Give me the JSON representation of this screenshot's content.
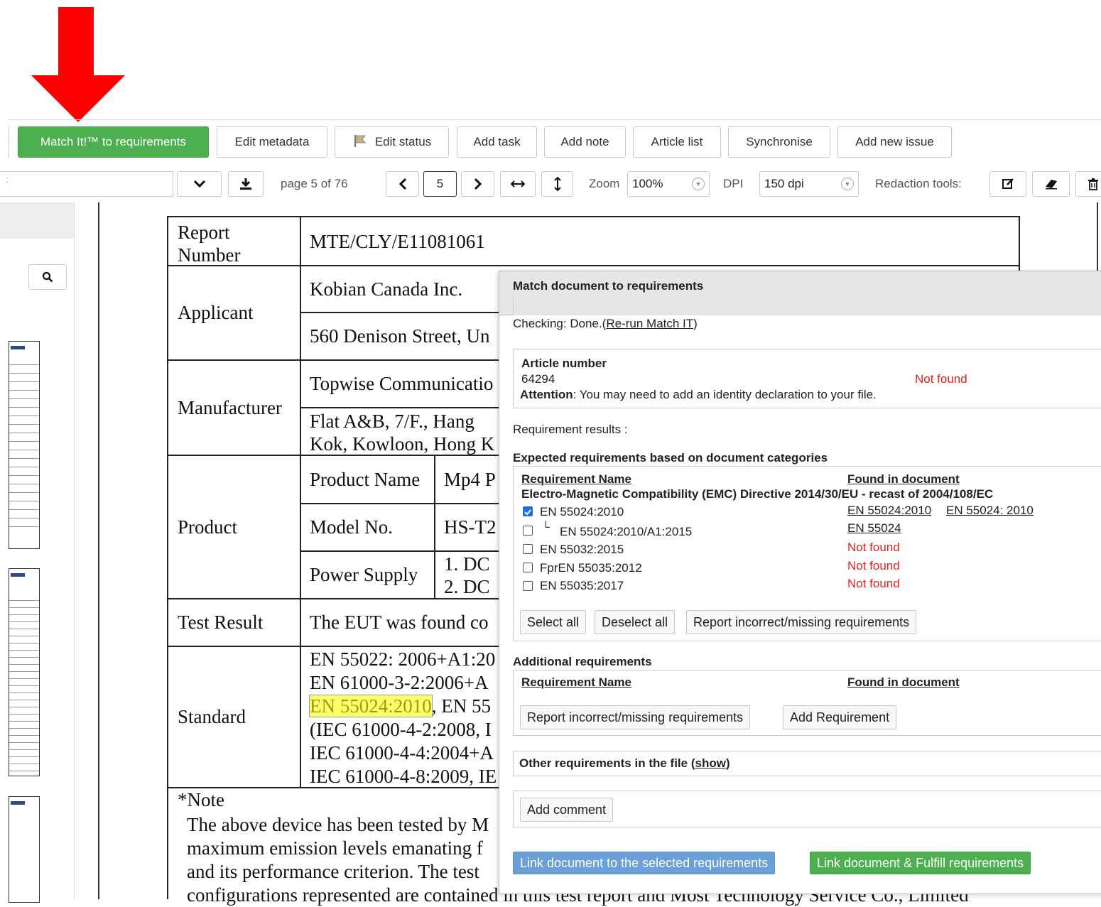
{
  "toolbar": {
    "match_label": "Match It!™ to requirements",
    "edit_metadata": "Edit metadata",
    "edit_status": "Edit status",
    "add_task": "Add task",
    "add_note": "Add note",
    "article_list": "Article list",
    "synchronise": "Synchronise",
    "add_new_issue": "Add new issue"
  },
  "viewer": {
    "page_info": "page 5 of 76",
    "page_input": "5",
    "zoom_label": "Zoom",
    "zoom_value": "100%",
    "dpi_label": "DPI",
    "dpi_value": "150 dpi",
    "redaction_label": "Redaction tools:"
  },
  "document": {
    "report_number_label_1": "Report",
    "report_number_label_2": "Number",
    "report_number": "MTE/CLY/E11081061",
    "applicant_label": "Applicant",
    "applicant_name": "Kobian Canada Inc.",
    "applicant_address": "560 Denison Street, Un",
    "manufacturer_label": "Manufacturer",
    "manufacturer_name": "Topwise Communicatio",
    "manufacturer_address_1": "Flat A&B, 7/F., Hang",
    "manufacturer_address_2": "Kok, Kowloon, Hong K",
    "product_label": "Product",
    "product_name_label": "Product Name",
    "product_name": "Mp4 P",
    "model_label": "Model No.",
    "model": "HS-T2",
    "power_label": "Power Supply",
    "power_1": "1. DC",
    "power_2": "2. DC",
    "test_result_label": "Test Result",
    "test_result": "The EUT was found co",
    "standard_label": "Standard",
    "standard_1": "EN 55022: 2006+A1:20",
    "standard_2": "EN 61000-3-2:2006+A",
    "standard_3_hl": "EN 55024:2010",
    "standard_3_rest": ", EN 55",
    "standard_4": "(IEC 61000-4-2:2008, I",
    "standard_5": "IEC 61000-4-4:2004+A",
    "standard_6": "IEC 61000-4-8:2009, IE",
    "note_label": "*Note",
    "note_1": "The above device has been tested by M",
    "note_2": "maximum emission levels emanating f",
    "note_3": "and its performance criterion. The test",
    "note_4": "configurations represented are contained in this test report and Most Technology Service Co., Limited"
  },
  "panel": {
    "title": "Match document to requirements",
    "checking_prefix": "Checking: Done.(",
    "rerun_link": "Re-run Match IT",
    "checking_suffix": ")",
    "article_number_label": "Article number",
    "article_number": "64294",
    "article_status": "Not found",
    "attention_label": "Attention",
    "attention_text": ": You may need to add an identity declaration to your file.",
    "requirement_results": "Requirement results :",
    "expected_heading": "Expected requirements based on document categories",
    "col_name": "Requirement Name",
    "col_found": "Found in document",
    "directive": "Electro-Magnetic Compatibility (EMC) Directive 2014/30/EU - recast of 2004/108/EC",
    "requirements": [
      {
        "name": "EN 55024:2010",
        "checked": true,
        "found_1": "EN 55024:2010",
        "found_2": "EN 55024: 2010"
      },
      {
        "name": "EN 55024:2010/A1:2015",
        "prefix": "└",
        "checked": false,
        "found_1": "EN 55024"
      },
      {
        "name": "EN 55032:2015",
        "checked": false,
        "found_1": "Not found"
      },
      {
        "name": "FprEN 55035:2012",
        "checked": false,
        "found_1": "Not found"
      },
      {
        "name": "EN 55035:2017",
        "checked": false,
        "found_1": "Not found"
      }
    ],
    "select_all": "Select all",
    "deselect_all": "Deselect all",
    "report_incorrect": "Report incorrect/missing requirements",
    "additional_heading": "Additional requirements",
    "add_requirement": "Add Requirement",
    "other_prefix": "Other requirements in the file (",
    "other_show": "show",
    "other_suffix": ")",
    "add_comment": "Add comment",
    "link_selected": "Link document to the selected requirements",
    "link_fulfill": "Link document & Fulfill requirements"
  },
  "colors": {
    "arrow": "#ff0000",
    "green": "#4cb050",
    "blue": "#6a9fd8",
    "not_found": "#e0201c",
    "highlight": "#ffff66"
  }
}
